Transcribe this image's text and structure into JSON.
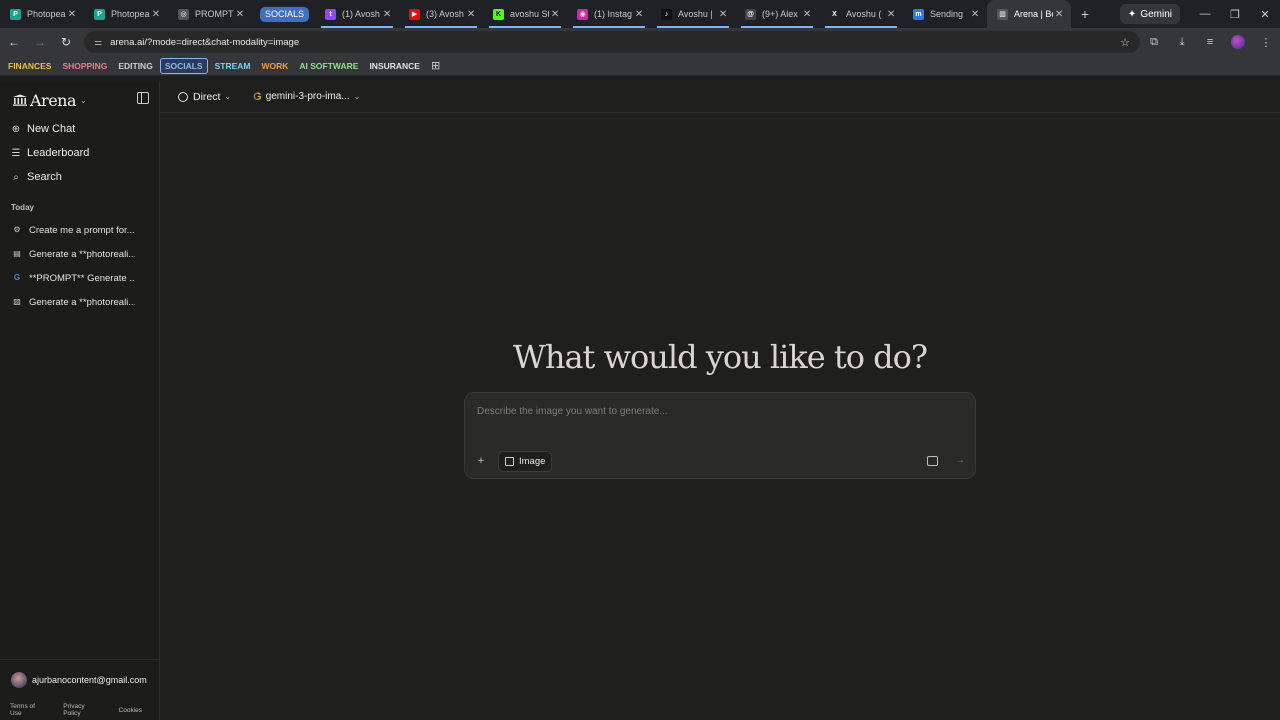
{
  "browser": {
    "tabs": [
      {
        "title": "Photopea",
        "fav_color": "#1aa58e",
        "fav_glyph": "P"
      },
      {
        "title": "Photopea",
        "fav_color": "#1aa58e",
        "fav_glyph": "P"
      },
      {
        "title": "PROMPTS",
        "fav_color": "#555555",
        "fav_glyph": "◎"
      },
      {
        "title": "(1) Avosh",
        "fav_color": "#9146ff",
        "fav_glyph": "t"
      },
      {
        "title": "(3) Avosh",
        "fav_color": "#ff0000",
        "fav_glyph": "▶"
      },
      {
        "title": "avoshu St",
        "fav_color": "#53fc18",
        "fav_glyph": "K"
      },
      {
        "title": "(1) Instag",
        "fav_color": "#d6249f",
        "fav_glyph": "◉"
      },
      {
        "title": "Avoshu | ",
        "fav_color": "#111111",
        "fav_glyph": "♪"
      },
      {
        "title": "(9+) Alex",
        "fav_color": "#444444",
        "fav_glyph": "@"
      },
      {
        "title": "Avoshu (",
        "fav_color": "#222222",
        "fav_glyph": "X"
      },
      {
        "title": "Sending ",
        "fav_color": "#2a7de1",
        "fav_glyph": "m"
      },
      {
        "title": "Arena | Be",
        "fav_color": "#555555",
        "fav_glyph": "▥"
      }
    ],
    "group_label": "SOCIALS",
    "gemini_label": "Gemini",
    "url": "arena.ai/?mode=direct&chat-modality=image",
    "bookmarks": [
      {
        "label": "FINANCES",
        "color": "#e6c04a"
      },
      {
        "label": "SHOPPING",
        "color": "#f07a8a"
      },
      {
        "label": "EDITING",
        "color": "#cccccc"
      },
      {
        "label": "SOCIALS",
        "color": "#8ab4f8"
      },
      {
        "label": "STREAM",
        "color": "#7cd3e8"
      },
      {
        "label": "WORK",
        "color": "#f0a040"
      },
      {
        "label": "AI SOFTWARE",
        "color": "#8ee08a"
      },
      {
        "label": "INSURANCE",
        "color": "#e0e0e0"
      }
    ]
  },
  "app": {
    "logo_text": "Arena",
    "nav": [
      {
        "label": "New Chat",
        "icon": "plus-circle-icon",
        "glyph": "⊕"
      },
      {
        "label": "Leaderboard",
        "icon": "list-icon",
        "glyph": "☰"
      },
      {
        "label": "Search",
        "icon": "search-icon",
        "glyph": "⌕"
      }
    ],
    "section_today": "Today",
    "history": [
      {
        "label": "Create me a prompt for...",
        "icon": "openai-icon",
        "glyph": "⚙"
      },
      {
        "label": "Generate a **photoreali...",
        "icon": "image-model-icon",
        "glyph": "▤"
      },
      {
        "label": "**PROMPT** Generate ...",
        "icon": "google-icon",
        "glyph": "G"
      },
      {
        "label": "Generate a **photoreali...",
        "icon": "image-model-icon",
        "glyph": "▨"
      }
    ],
    "user_email": "ajurbanocontent@gmail.com",
    "footer": [
      "Terms of Use",
      "Privacy Policy",
      "Cookies"
    ],
    "mode_label": "Direct",
    "model_label": "gemini-3-pro-ima...",
    "hero_title": "What would you like to do?",
    "composer": {
      "placeholder": "Describe the image you want to generate...",
      "image_chip": "Image"
    }
  }
}
